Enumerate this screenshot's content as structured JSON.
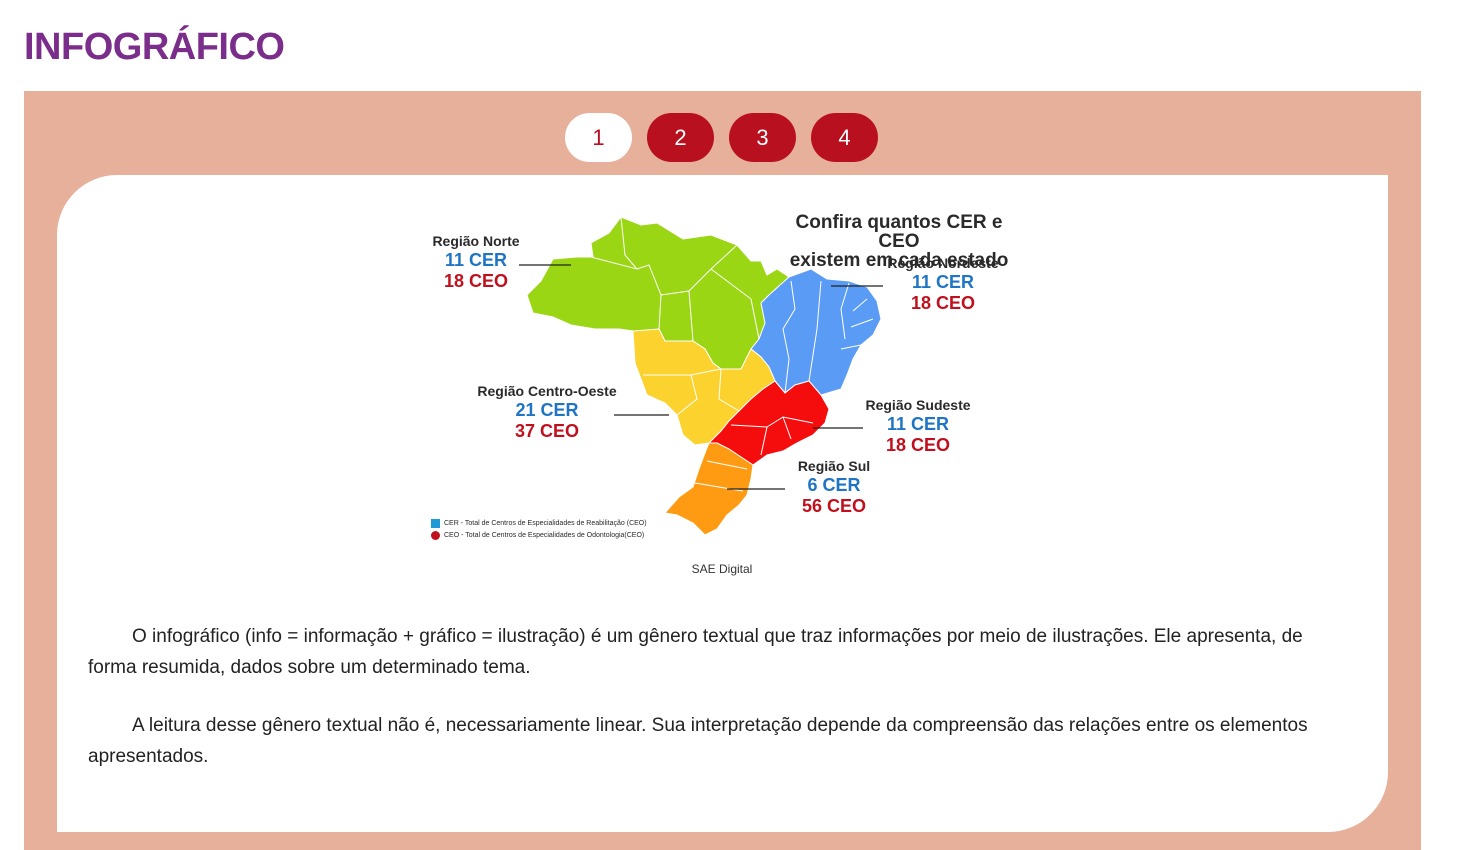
{
  "page_title": "INFOGRÁFICO",
  "pager": {
    "pages": [
      "1",
      "2",
      "3",
      "4"
    ],
    "active_index": 0
  },
  "infographic": {
    "title_line1": "Confira quantos CER e CEO",
    "title_line2": "existem em cada estado",
    "regions": {
      "norte": {
        "name": "Região Norte",
        "cer": "11 CER",
        "ceo": "18 CEO"
      },
      "nordeste": {
        "name": "Região Nordeste",
        "cer": "11 CER",
        "ceo": "18 CEO"
      },
      "centro_oeste": {
        "name": "Região Centro-Oeste",
        "cer": "21 CER",
        "ceo": "37 CEO"
      },
      "sudeste": {
        "name": "Região Sudeste",
        "cer": "11 CER",
        "ceo": "18 CEO"
      },
      "sul": {
        "name": "Região Sul",
        "cer": "6 CER",
        "ceo": "56 CEO"
      }
    },
    "legend": {
      "cer": "CER - Total de Centros de Especialidades de Reabilitação (CEO)",
      "ceo": "CEO - Total de Centros de Especialidades de Odontologia(CEO)"
    },
    "region_colors": {
      "norte": "#9ad614",
      "nordeste": "#5a9cf5",
      "centro_oeste": "#fcd22e",
      "sudeste": "#f50d0d",
      "sul": "#ff9b12"
    }
  },
  "credit": "SAE Digital",
  "paragraphs": [
    "O infográfico (info = informação + gráfico = ilustração) é um gênero textual que traz informações por meio de ilustrações. Ele apresenta, de forma resumida, dados sobre um determinado tema.",
    "A leitura desse gênero textual não é, necessariamente linear. Sua interpretação depende da compreensão das relações entre os elementos apresentados."
  ],
  "colors": {
    "title": "#7b2d8b",
    "panel_bg": "#e6b09a",
    "pager_red": "#b8101f",
    "cer_blue": "#1f74c4",
    "ceo_red": "#c0101e"
  }
}
